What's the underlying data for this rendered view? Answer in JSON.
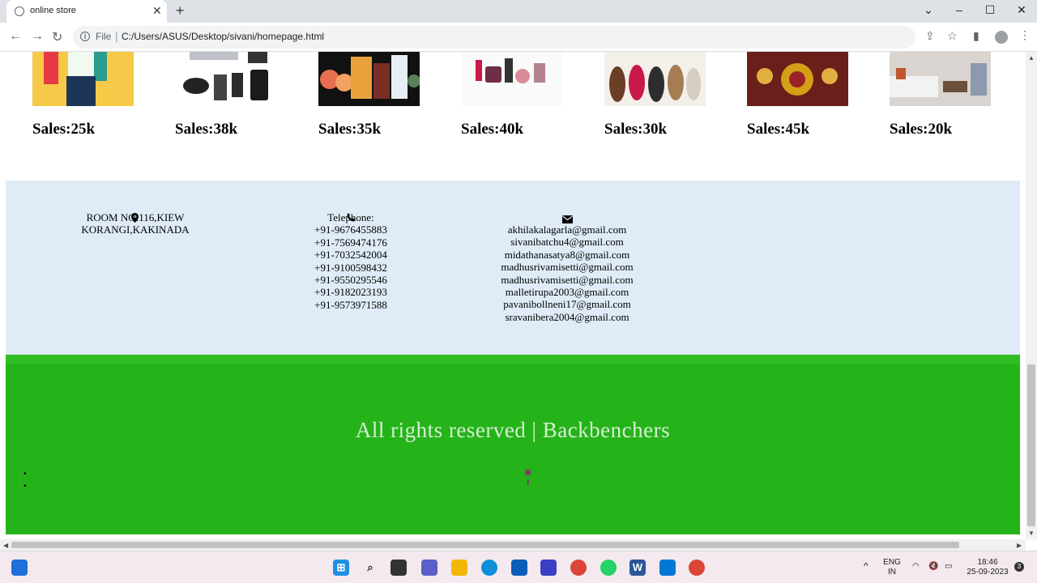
{
  "browser": {
    "tab_title": "online store",
    "url_scheme": "File",
    "url": "C:/Users/ASUS/Desktop/sivani/homepage.html"
  },
  "products": [
    {
      "sales": "Sales:25k",
      "image": "shopping-fashion-photo"
    },
    {
      "sales": "Sales:38k",
      "image": "electronics-gadgets-photo"
    },
    {
      "sales": "Sales:35k",
      "image": "groceries-photo"
    },
    {
      "sales": "Sales:40k",
      "image": "cosmetics-photo"
    },
    {
      "sales": "Sales:30k",
      "image": "footwear-photo"
    },
    {
      "sales": "Sales:45k",
      "image": "jewellery-photo"
    },
    {
      "sales": "Sales:20k",
      "image": "furniture-photo"
    }
  ],
  "contact": {
    "address": [
      "ROOM NO:116,KIEW",
      "KORANGI,KAKINADA"
    ],
    "telephone_label": "Telephone:",
    "phones": [
      "+91-9676455883",
      "+91-7569474176",
      "+91-7032542004",
      "+91-9100598432",
      "+91-9550295546",
      "+91-9182023193",
      "+91-9573971588"
    ],
    "emails": [
      "akhilakalagarla@gmail.com",
      "sivanibatchu4@gmail.com",
      "midathanasatya8@gmail.com",
      "madhusrivamisetti@gmail.com",
      "madhusrivamisetti@gmail.com",
      "malletirupa2003@gmail.com",
      "pavanibollneni17@gmail.com",
      "sravanibera2004@gmail.com"
    ]
  },
  "footer": {
    "rights": "All rights reserved | Backbenchers",
    "bullets": [
      "•",
      "•"
    ]
  },
  "taskbar": {
    "lang_top": "ENG",
    "lang_bottom": "IN",
    "time": "18:46",
    "date": "25-09-2023",
    "notifications": "3"
  },
  "colors": {
    "contact_bg": "#dfecf7",
    "footer_bg": "#25b31a",
    "rights_text": "#d6efd2"
  }
}
